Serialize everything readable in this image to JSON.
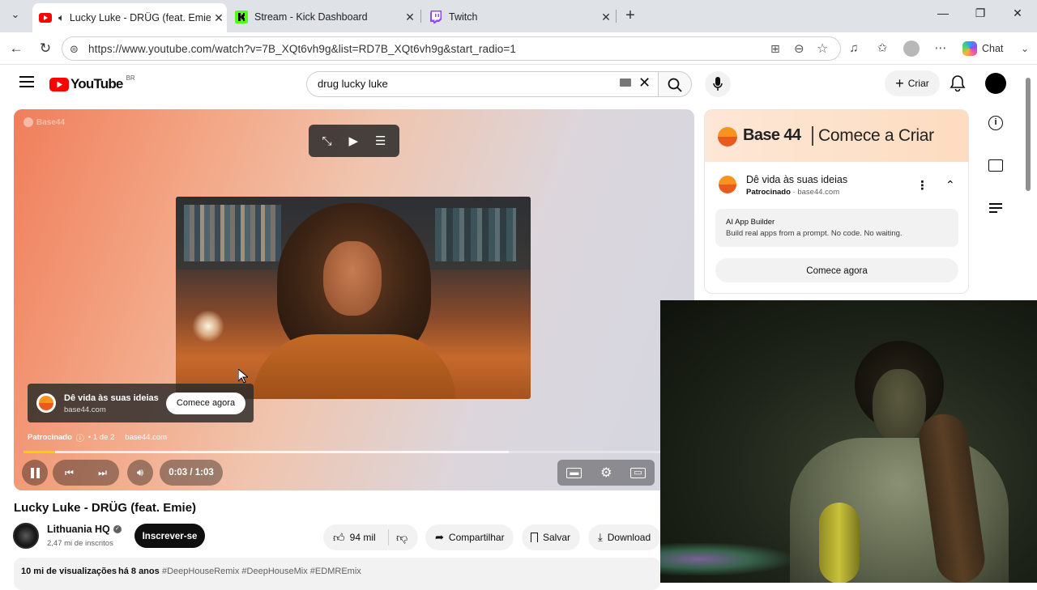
{
  "browser": {
    "tabs": [
      {
        "title": "Lucky Luke - DRÜG (feat. Emie",
        "active": true
      },
      {
        "title": "Stream - Kick Dashboard",
        "active": false
      },
      {
        "title": "Twitch",
        "active": false
      }
    ],
    "url": "https://www.youtube.com/watch?v=7B_XQt6vh9g&list=RD7B_XQt6vh9g&start_radio=1",
    "copilot_label": "Chat"
  },
  "youtube": {
    "logo_text": "YouTube",
    "region": "BR",
    "search_value": "drug lucky luke",
    "create_label": "Criar"
  },
  "player": {
    "watermark": "Base44",
    "overlay_ad": {
      "title": "Dê vida às suas ideias",
      "domain": "base44.com",
      "cta": "Comece agora"
    },
    "sponsor_line": {
      "label": "Patrocinado",
      "count": "• 1 de 2",
      "domain": "base44.com"
    },
    "time": "0:03 / 1:03",
    "progress_fraction": 0.05,
    "buffer_fraction": 0.76
  },
  "video": {
    "title": "Lucky Luke - DRÜG (feat. Emie)",
    "channel": "Lithuania HQ",
    "subscribers": "2,47 mi de inscritos",
    "subscribe_label": "Inscrever-se",
    "likes": "94 mil",
    "share_label": "Compartilhar",
    "save_label": "Salvar",
    "download_label": "Download",
    "views": "10 mi de visualizações",
    "age": "há 8 anos",
    "tags": "#DeepHouseRemix #DeepHouseMix #EDMREmix"
  },
  "sidebar_ad": {
    "banner_brand": "Base 44",
    "banner_tagline": "Comece a Criar",
    "title": "Dê vida às suas ideias",
    "sponsored": "Patrocinado",
    "domain": "base44.com",
    "box_title": "AI App Builder",
    "box_text": "Build real apps from a prompt. No code. No waiting.",
    "cta": "Comece agora"
  },
  "colors": {
    "youtube_red": "#ff0000",
    "base44_orange": "#f26a1b",
    "progress_yellow": "#f5d000"
  }
}
